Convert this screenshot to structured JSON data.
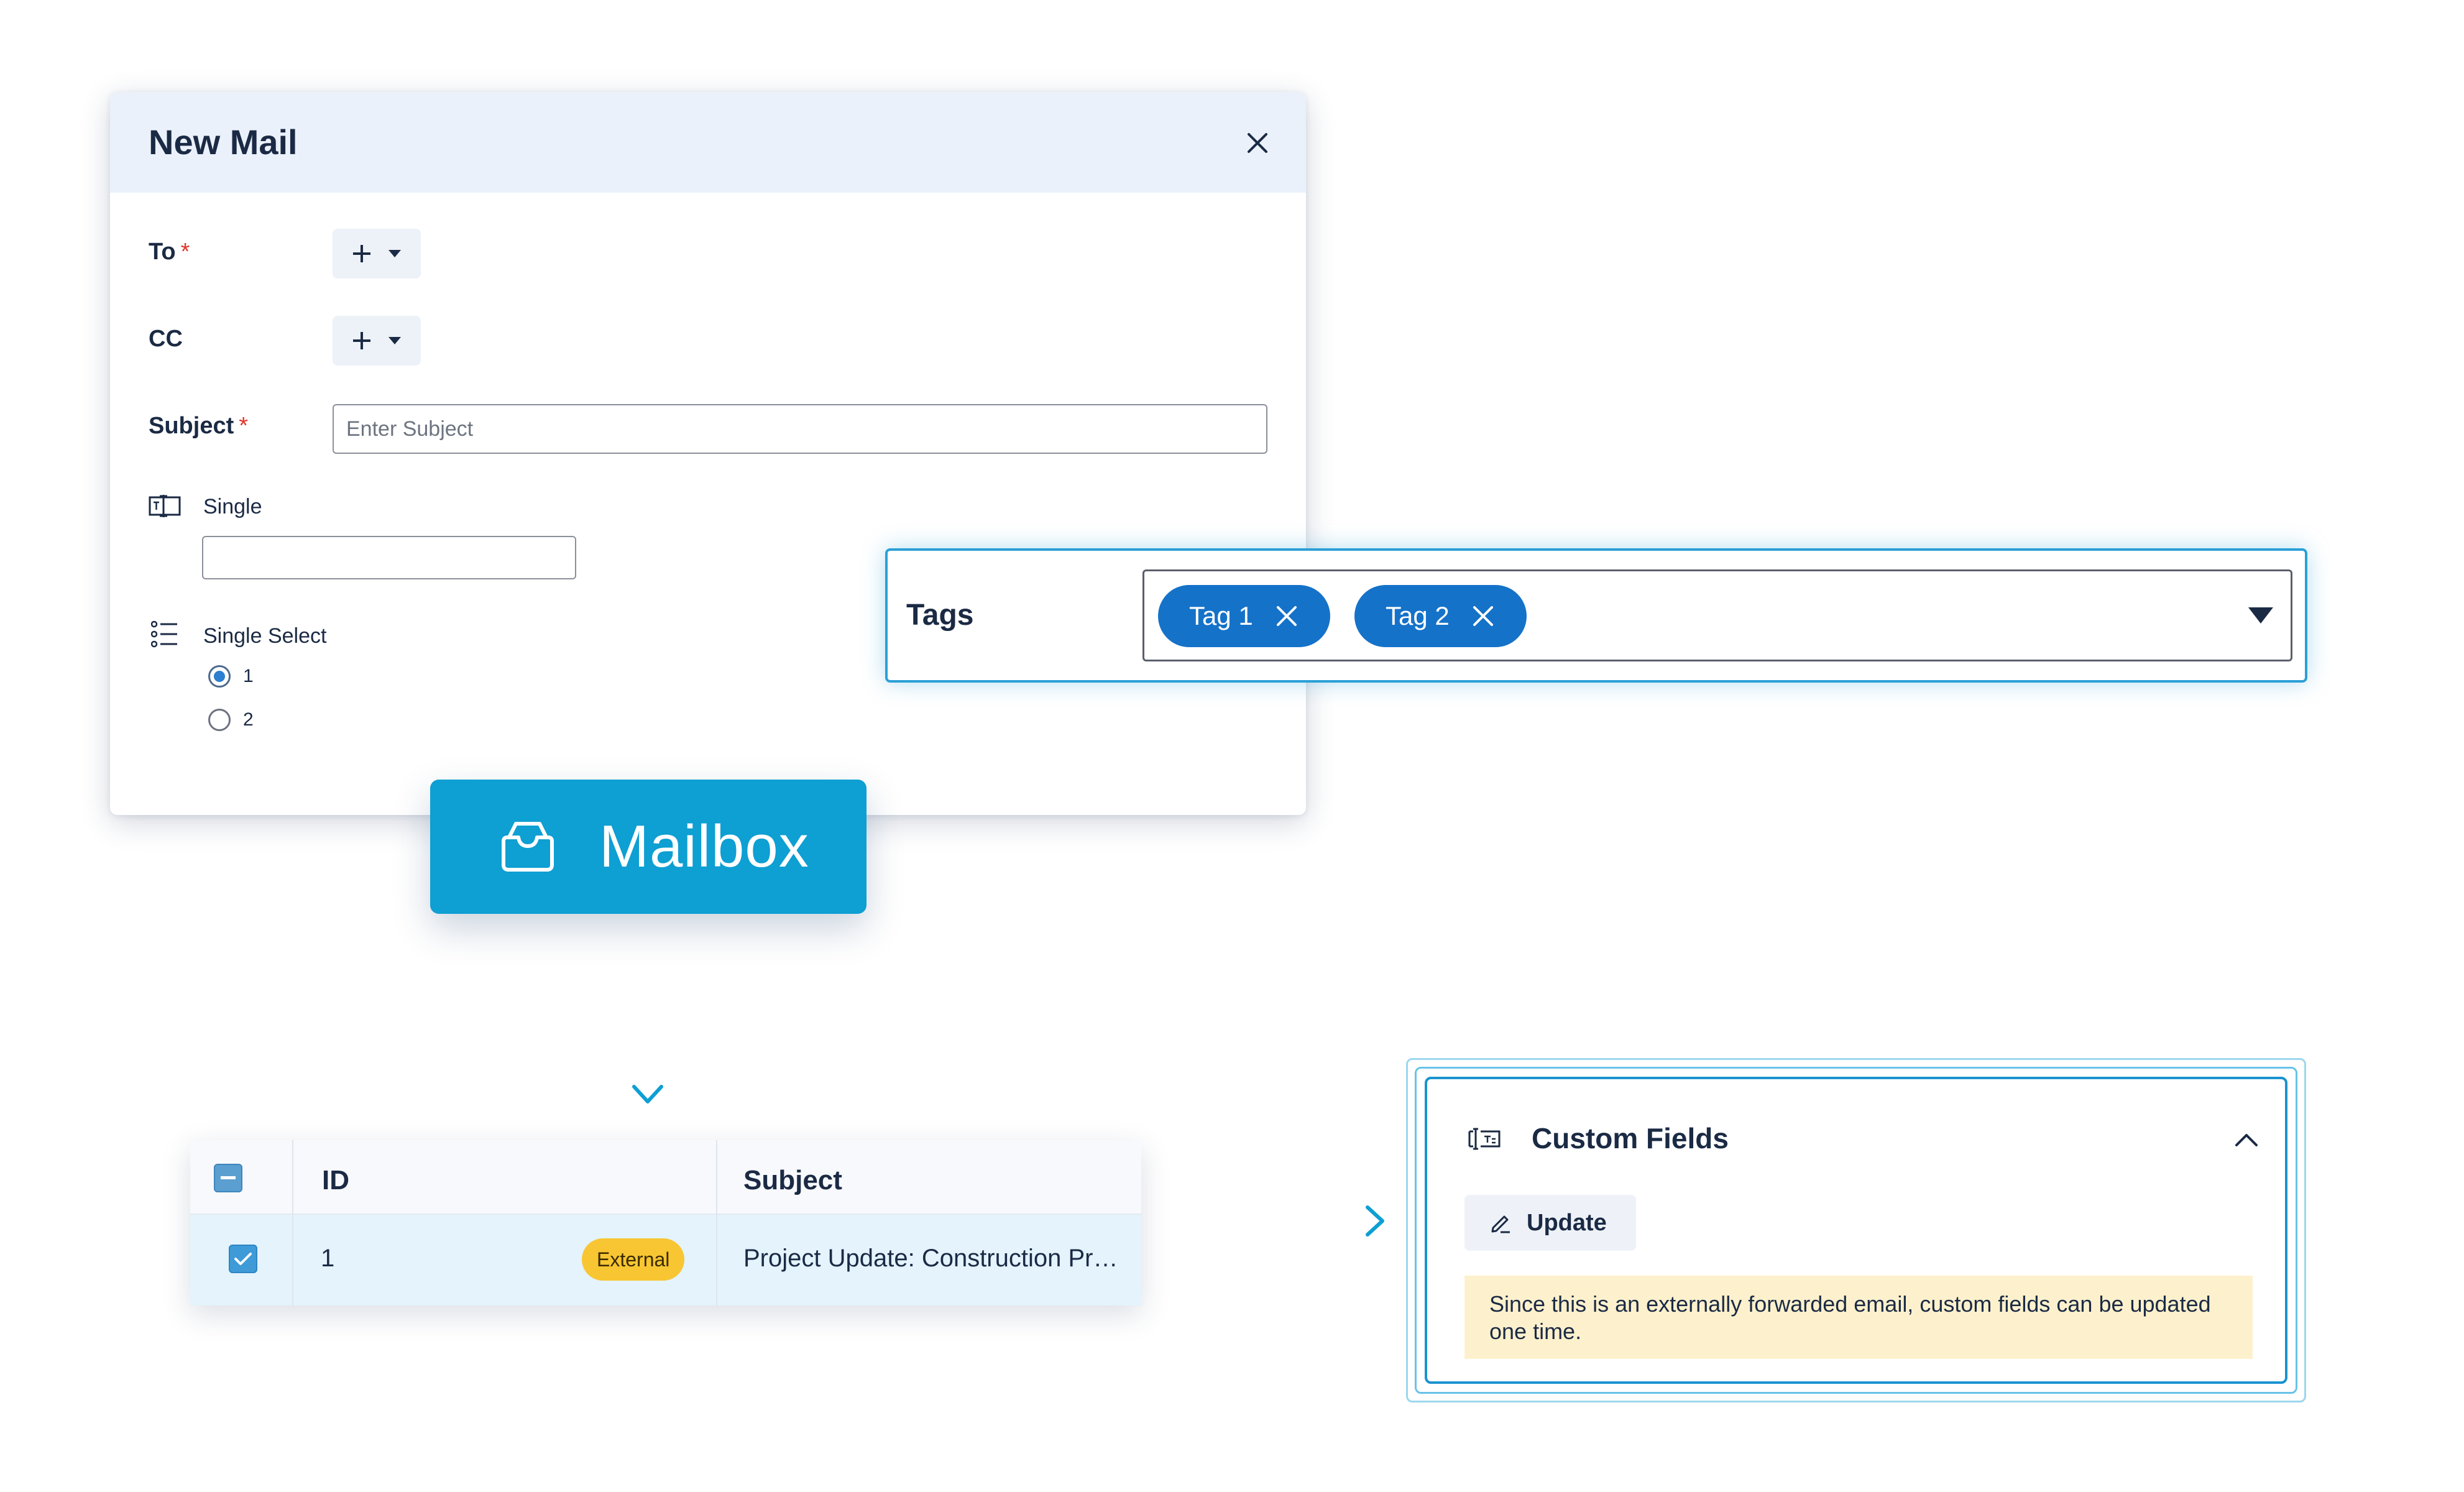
{
  "new_mail": {
    "title": "New Mail",
    "to_label": "To",
    "cc_label": "CC",
    "subject_label": "Subject",
    "required_mark": "*",
    "subject_placeholder": "Enter Subject",
    "single_label": "Single",
    "single_select_label": "Single Select",
    "options": [
      "1",
      "2"
    ],
    "selected_option": "1"
  },
  "tags": {
    "label": "Tags",
    "chips": [
      "Tag 1",
      "Tag 2"
    ]
  },
  "mailbox": {
    "label": "Mailbox"
  },
  "table": {
    "headers": {
      "id": "ID",
      "subject": "Subject"
    },
    "rows": [
      {
        "id": "1",
        "badge": "External",
        "subject": "Project Update: Construction Pr…",
        "checked": true
      }
    ]
  },
  "custom_fields": {
    "title": "Custom Fields",
    "update_label": "Update",
    "notice": "Since this is an externally forwarded email, custom fields can be updated one time."
  },
  "colors": {
    "accent": "#0e9fd3",
    "chip": "#1572c9",
    "badge": "#f8c632",
    "notice_bg": "#fdf1cd",
    "required": "#e0362c"
  },
  "icons": [
    "close-icon",
    "plus-icon",
    "caret-down-icon",
    "text-field-icon",
    "list-icon",
    "inbox-icon",
    "check-icon",
    "minus-icon",
    "chevron-up-icon",
    "edit-icon",
    "custom-field-icon",
    "arrow-down-icon",
    "arrow-right-icon"
  ]
}
